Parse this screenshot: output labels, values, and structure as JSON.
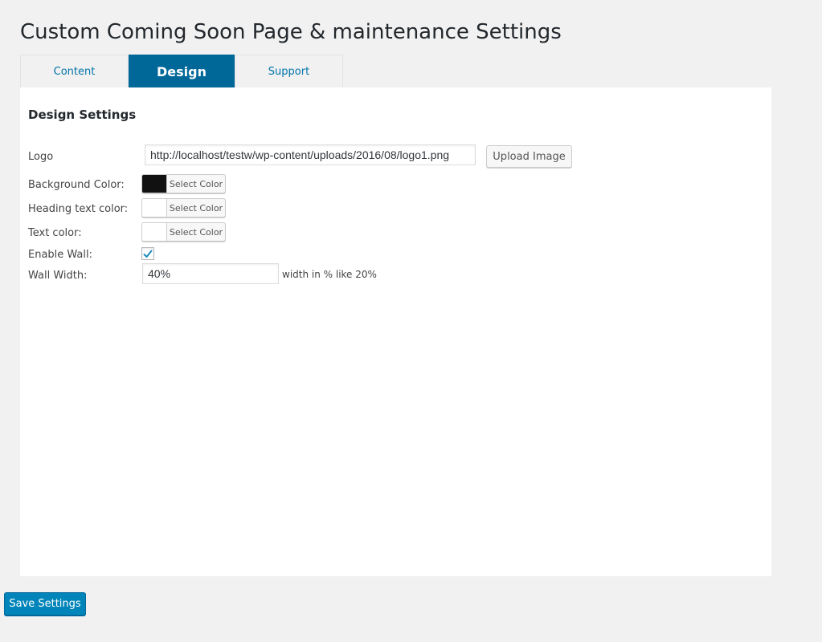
{
  "page_title": "Custom Coming Soon Page & maintenance Settings",
  "tabs": [
    {
      "label": "Content",
      "active": false
    },
    {
      "label": "Design",
      "active": true
    },
    {
      "label": "Support",
      "active": false
    }
  ],
  "design": {
    "heading": "Design Settings",
    "logo": {
      "label": "Logo",
      "value": "http://localhost/testw/wp-content/uploads/2016/08/logo1.png",
      "upload_button": "Upload Image"
    },
    "background_color": {
      "label": "Background Color:",
      "swatch": "#111111",
      "picker_label": "Select Color"
    },
    "heading_text_color": {
      "label": "Heading text color:",
      "swatch": "#ffffff",
      "picker_label": "Select Color"
    },
    "text_color": {
      "label": "Text color:",
      "swatch": "#ffffff",
      "picker_label": "Select Color"
    },
    "enable_wall": {
      "label": "Enable Wall:",
      "checked": true
    },
    "wall_width": {
      "label": "Wall Width:",
      "value": "40%",
      "hint": "width in % like 20%"
    }
  },
  "save_button": "Save Settings",
  "colors": {
    "accent": "#0085ba",
    "active_tab": "#006799",
    "checkmark": "#1e8cbe"
  }
}
